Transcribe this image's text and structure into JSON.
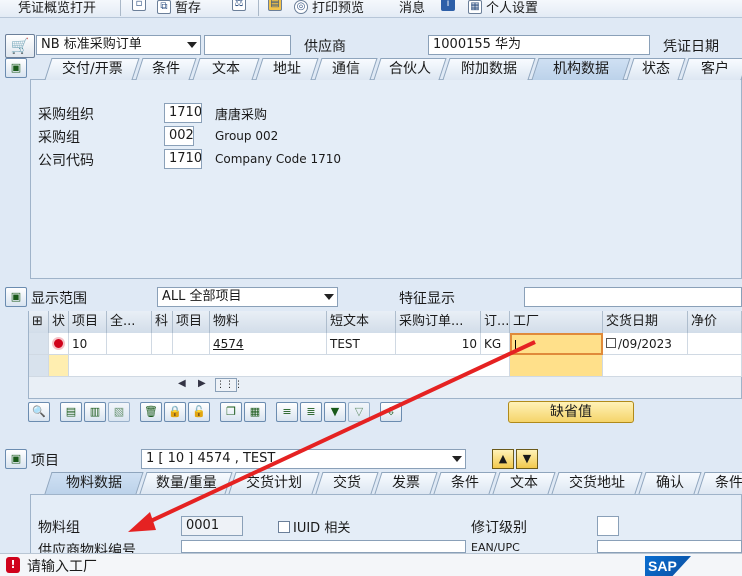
{
  "toolbar": {
    "overview_label": "凭证概览打开",
    "hold_label": "暂存",
    "print_preview_label": "打印预览",
    "messages_label": "消息",
    "personal_settings_label": "个人设置"
  },
  "header": {
    "doc_type_value": "NB 标准采购订单",
    "doc_number_value": "",
    "vendor_label": "供应商",
    "vendor_value": "1000155 华为",
    "doc_date_label": "凭证日期"
  },
  "header_tabs": [
    "交付/开票",
    "条件",
    "文本",
    "地址",
    "通信",
    "合伙人",
    "附加数据",
    "机构数据",
    "状态",
    "客户"
  ],
  "org_data": {
    "purch_org_label": "采购组织",
    "purch_org_value": "1710",
    "purch_org_desc": "唐唐采购",
    "purch_group_label": "采购组",
    "purch_group_value": "002",
    "purch_group_desc": "Group 002",
    "company_code_label": "公司代码",
    "company_code_value": "1710",
    "company_code_desc": "Company Code 1710"
  },
  "items_overview": {
    "display_range_label": "显示范围",
    "display_range_value": "ALL 全部项目",
    "char_display_label": "特征显示",
    "char_display_value": "",
    "columns": [
      "状",
      "项目",
      "全...",
      "科",
      "项目",
      "物料",
      "短文本",
      "采购订单...",
      "订...",
      "工厂",
      "交货日期",
      "净价"
    ],
    "row": {
      "item": "10",
      "material": "4574",
      "short_text": "TEST",
      "po_qty": "10",
      "unit": "KG",
      "plant": "",
      "delivery_date": "/09/2023"
    },
    "default_button_label": "缺省值"
  },
  "item_detail": {
    "item_label": "项目",
    "item_value": "1 [ 10 ] 4574 , TEST",
    "tabs": [
      "物料数据",
      "数量/重量",
      "交货计划",
      "交货",
      "发票",
      "条件",
      "文本",
      "交货地址",
      "确认",
      "条件"
    ],
    "material_group_label": "物料组",
    "material_group_value": "0001",
    "iuid_label": "IUID 相关",
    "revision_label": "修订级别",
    "revision_value": "",
    "vendor_material_label": "供应商物料编号",
    "ean_label": "EAN/UPC"
  },
  "status": {
    "message": "请输入工厂",
    "brand": "SAP"
  },
  "colors": {
    "background": "#dfe9f5",
    "error_red": "#d0021b",
    "highlight_field": "#ffe08a",
    "arrow": "#e52222"
  }
}
